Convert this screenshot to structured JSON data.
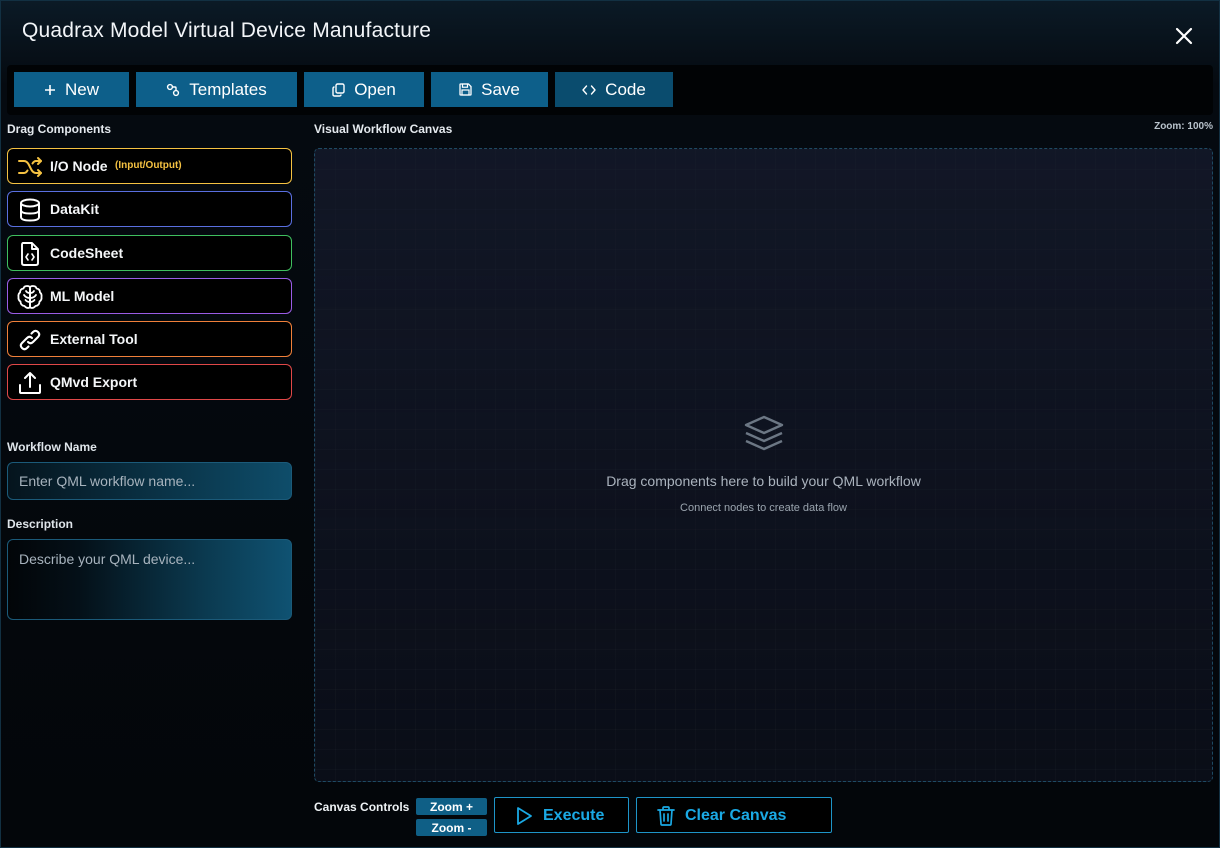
{
  "window": {
    "title": "Quadrax Model Virtual Device Manufacture"
  },
  "toolbar": [
    {
      "label": "New",
      "icon": "plus-icon"
    },
    {
      "label": "Templates",
      "icon": "templates-icon"
    },
    {
      "label": "Open",
      "icon": "copy-icon"
    },
    {
      "label": "Save",
      "icon": "save-icon"
    },
    {
      "label": "Code",
      "icon": "code-icon"
    }
  ],
  "sidebar": {
    "heading": "Drag Components",
    "components": [
      {
        "label": "I/O Node",
        "sublabel": "(Input/Output)",
        "icon": "shuffle-icon",
        "color": "#f5c242"
      },
      {
        "label": "DataKit",
        "icon": "database-icon",
        "color": "#5a6fe0"
      },
      {
        "label": "CodeSheet",
        "icon": "code-file-icon",
        "color": "#3fbf5f"
      },
      {
        "label": "ML Model",
        "icon": "brain-icon",
        "color": "#9a5ce6"
      },
      {
        "label": "External Tool",
        "icon": "link-icon",
        "color": "#f0803a"
      },
      {
        "label": "QMvd Export",
        "icon": "upload-icon",
        "color": "#e04848"
      }
    ],
    "workflow_name": {
      "label": "Workflow Name",
      "placeholder": "Enter QML workflow name...",
      "value": ""
    },
    "description": {
      "label": "Description",
      "placeholder": "Describe your QML device...",
      "value": ""
    }
  },
  "canvas": {
    "heading": "Visual Workflow Canvas",
    "zoom_text": "Zoom: 100%",
    "empty_icon": "layers-icon",
    "empty_message": "Drag components here to build your QML workflow",
    "empty_sub": "Connect nodes to create data flow"
  },
  "controls": {
    "label": "Canvas Controls",
    "zoom_in": "Zoom +",
    "zoom_out": "Zoom -",
    "execute": "Execute",
    "clear": "Clear Canvas",
    "accent": "#1aa9e4"
  }
}
